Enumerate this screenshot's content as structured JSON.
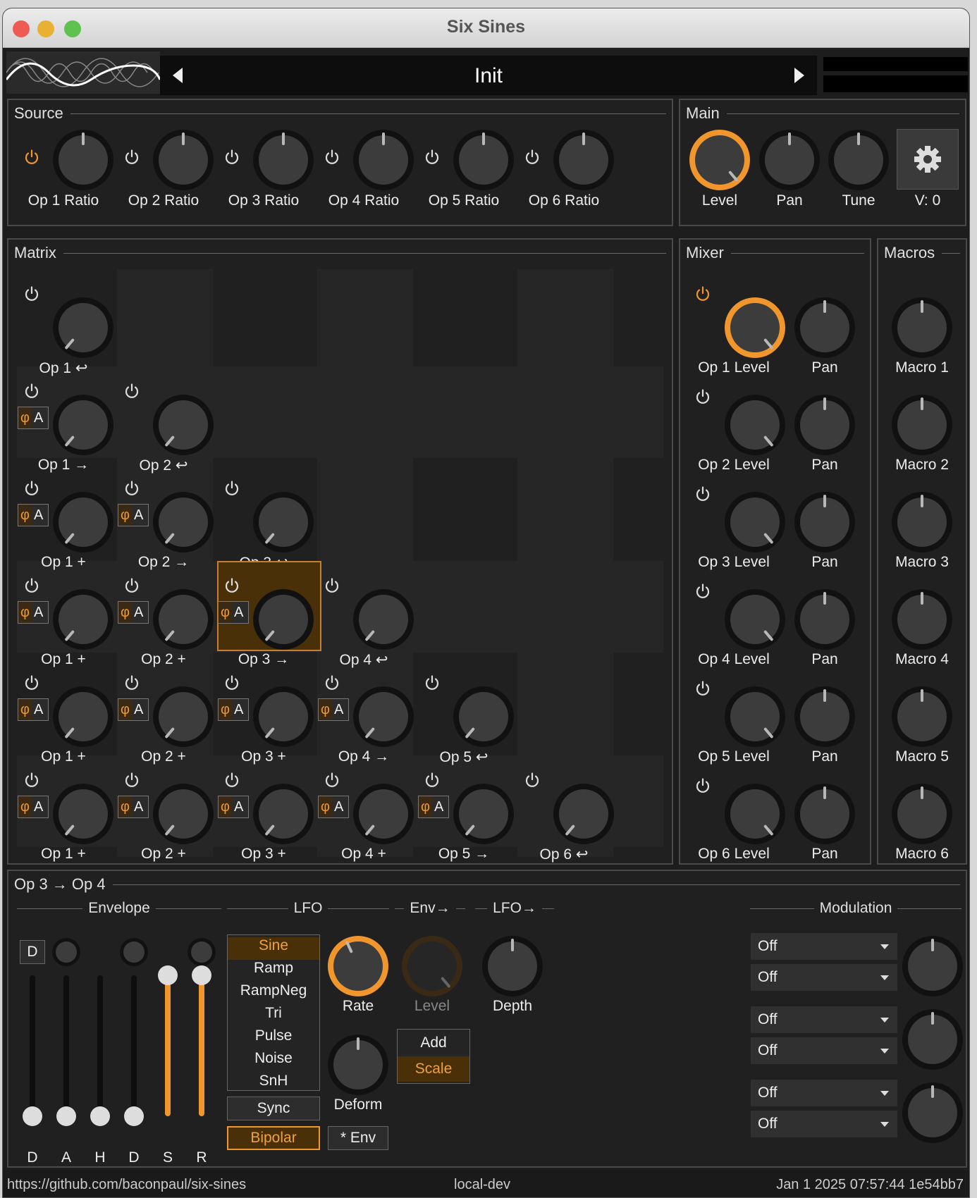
{
  "window": {
    "title": "Six Sines"
  },
  "preset": {
    "name": "Init"
  },
  "source": {
    "title": "Source",
    "knobs": [
      "Op 1 Ratio",
      "Op 2 Ratio",
      "Op 3 Ratio",
      "Op 4 Ratio",
      "Op 5 Ratio",
      "Op 6 Ratio"
    ]
  },
  "main": {
    "title": "Main",
    "level": "Level",
    "pan": "Pan",
    "tune": "Tune",
    "voices": "V: 0"
  },
  "matrix": {
    "title": "Matrix",
    "phi": "φ",
    "amp": "A",
    "rows": [
      [
        "Op 1 ↩"
      ],
      [
        "Op 1 →",
        "Op 2 ↩"
      ],
      [
        "Op 1 +",
        "Op 2 →",
        "Op 3 ↩"
      ],
      [
        "Op 1 +",
        "Op 2 +",
        "Op 3 →",
        "Op 4 ↩"
      ],
      [
        "Op 1 +",
        "Op 2 +",
        "Op 3 +",
        "Op 4 →",
        "Op 5 ↩"
      ],
      [
        "Op 1 +",
        "Op 2 +",
        "Op 3 +",
        "Op 4 +",
        "Op 5 →",
        "Op 6 ↩"
      ]
    ]
  },
  "mixer": {
    "title": "Mixer",
    "levels": [
      "Op 1 Level",
      "Op 2 Level",
      "Op 3 Level",
      "Op 4 Level",
      "Op 5 Level",
      "Op 6 Level"
    ],
    "pan": "Pan"
  },
  "macros": {
    "title": "Macros",
    "items": [
      "Macro 1",
      "Macro 2",
      "Macro 3",
      "Macro 4",
      "Macro 5",
      "Macro 6"
    ]
  },
  "editor": {
    "title": "Op 3 → Op 4",
    "envelope": "Envelope",
    "lfo": "LFO",
    "env_arrow": "Env→",
    "lfo_arrow": "LFO→",
    "modulation": "Modulation",
    "delay_btn": "D",
    "env_sliders": [
      "D",
      "A",
      "H",
      "D",
      "S",
      "R"
    ],
    "lfo_shapes": [
      "Sine",
      "Ramp",
      "RampNeg",
      "Tri",
      "Pulse",
      "Noise",
      "SnH"
    ],
    "rate": "Rate",
    "level": "Level",
    "depth": "Depth",
    "deform": "Deform",
    "add": "Add",
    "scale": "Scale",
    "sync": "Sync",
    "bipolar": "Bipolar",
    "env_mul": "* Env",
    "mod_sources": [
      "Off",
      "Off",
      "Off",
      "Off",
      "Off",
      "Off"
    ]
  },
  "status": {
    "url": "https://github.com/baconpaul/six-sines",
    "build": "local-dev",
    "date": "Jan  1 2025 07:57:44 1e54bb7"
  },
  "colors": {
    "accent": "#f0962c",
    "bg": "#1d1d1d",
    "panel_border": "#4a4a4a"
  }
}
